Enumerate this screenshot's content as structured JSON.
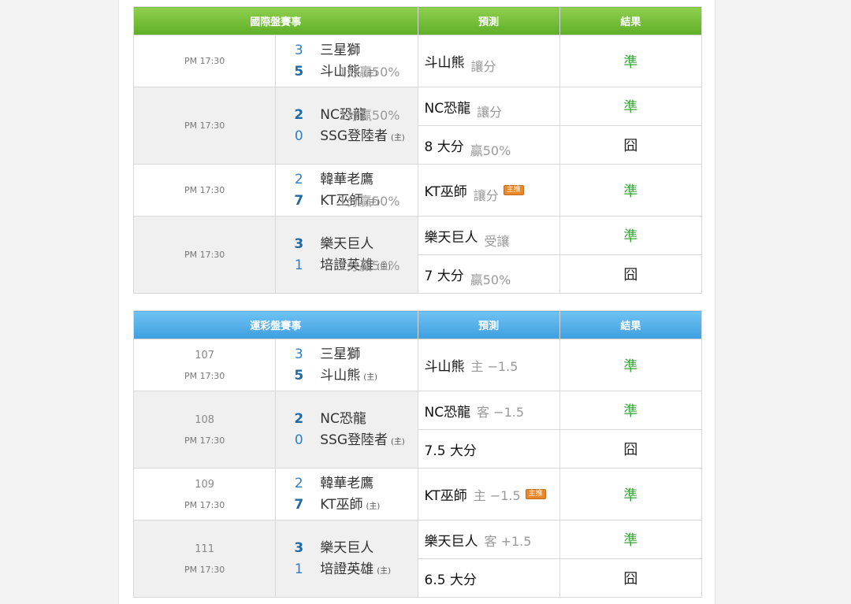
{
  "home_mark": "(主)",
  "badge_label": "主推",
  "colors": {
    "header_green": "#6cbf35",
    "header_blue": "#49a8e6",
    "score_blue": "#2f7fc2",
    "result_correct": "#3aa53a"
  },
  "intl": {
    "headers": {
      "matches": "國際盤賽事",
      "prediction": "預測",
      "result": "結果"
    },
    "games": [
      {
        "time": "PM 17:30",
        "away": {
          "score": "3",
          "name": "三星獅"
        },
        "home": {
          "score": "5",
          "name": "斗山熊"
        },
        "line": "1分贏50%",
        "picks": [
          {
            "team": "斗山熊",
            "sub": "讓分",
            "result": "準"
          }
        ]
      },
      {
        "time": "PM 17:30",
        "away": {
          "score": "2",
          "name": "NC恐龍"
        },
        "home": {
          "score": "0",
          "name": "SSG登陸者"
        },
        "line": "1分贏50%",
        "picks": [
          {
            "team": "NC恐龍",
            "sub": "讓分",
            "result": "準"
          },
          {
            "team": "8 大分",
            "sub": "贏50%",
            "result": "囧"
          }
        ]
      },
      {
        "time": "PM 17:30",
        "away": {
          "score": "2",
          "name": "韓華老鷹"
        },
        "home": {
          "score": "7",
          "name": "KT巫師"
        },
        "line": "1分贏50%",
        "picks": [
          {
            "team": "KT巫師",
            "sub": "讓分",
            "result": "準"
          }
        ]
      },
      {
        "time": "PM 17:30",
        "away": {
          "score": "3",
          "name": "樂天巨人"
        },
        "home": {
          "score": "1",
          "name": "培證英雄"
        },
        "line": "1分贏50%",
        "picks": [
          {
            "team": "樂天巨人",
            "sub": "受讓",
            "result": "準"
          },
          {
            "team": "7 大分",
            "sub": "贏50%",
            "result": "囧"
          }
        ]
      }
    ]
  },
  "lottery": {
    "headers": {
      "matches": "運彩盤賽事",
      "prediction": "預測",
      "result": "結果"
    },
    "games": [
      {
        "num": "107",
        "time": "PM 17:30",
        "away": {
          "score": "3",
          "name": "三星獅"
        },
        "home": {
          "score": "5",
          "name": "斗山熊"
        },
        "picks": [
          {
            "team": "斗山熊",
            "sub": "主 −1.5",
            "result": "準"
          }
        ]
      },
      {
        "num": "108",
        "time": "PM 17:30",
        "away": {
          "score": "2",
          "name": "NC恐龍"
        },
        "home": {
          "score": "0",
          "name": "SSG登陸者"
        },
        "picks": [
          {
            "team": "NC恐龍",
            "sub": "客 −1.5",
            "result": "準"
          },
          {
            "team": "7.5 大分",
            "sub": "",
            "result": "囧"
          }
        ]
      },
      {
        "num": "109",
        "time": "PM 17:30",
        "away": {
          "score": "2",
          "name": "韓華老鷹"
        },
        "home": {
          "score": "7",
          "name": "KT巫師"
        },
        "picks": [
          {
            "team": "KT巫師",
            "sub": "主 −1.5",
            "result": "準"
          }
        ]
      },
      {
        "num": "111",
        "time": "PM 17:30",
        "away": {
          "score": "3",
          "name": "樂天巨人"
        },
        "home": {
          "score": "1",
          "name": "培證英雄"
        },
        "picks": [
          {
            "team": "樂天巨人",
            "sub": "客 +1.5",
            "result": "準"
          },
          {
            "team": "6.5 大分",
            "sub": "",
            "result": "囧"
          }
        ]
      }
    ]
  }
}
